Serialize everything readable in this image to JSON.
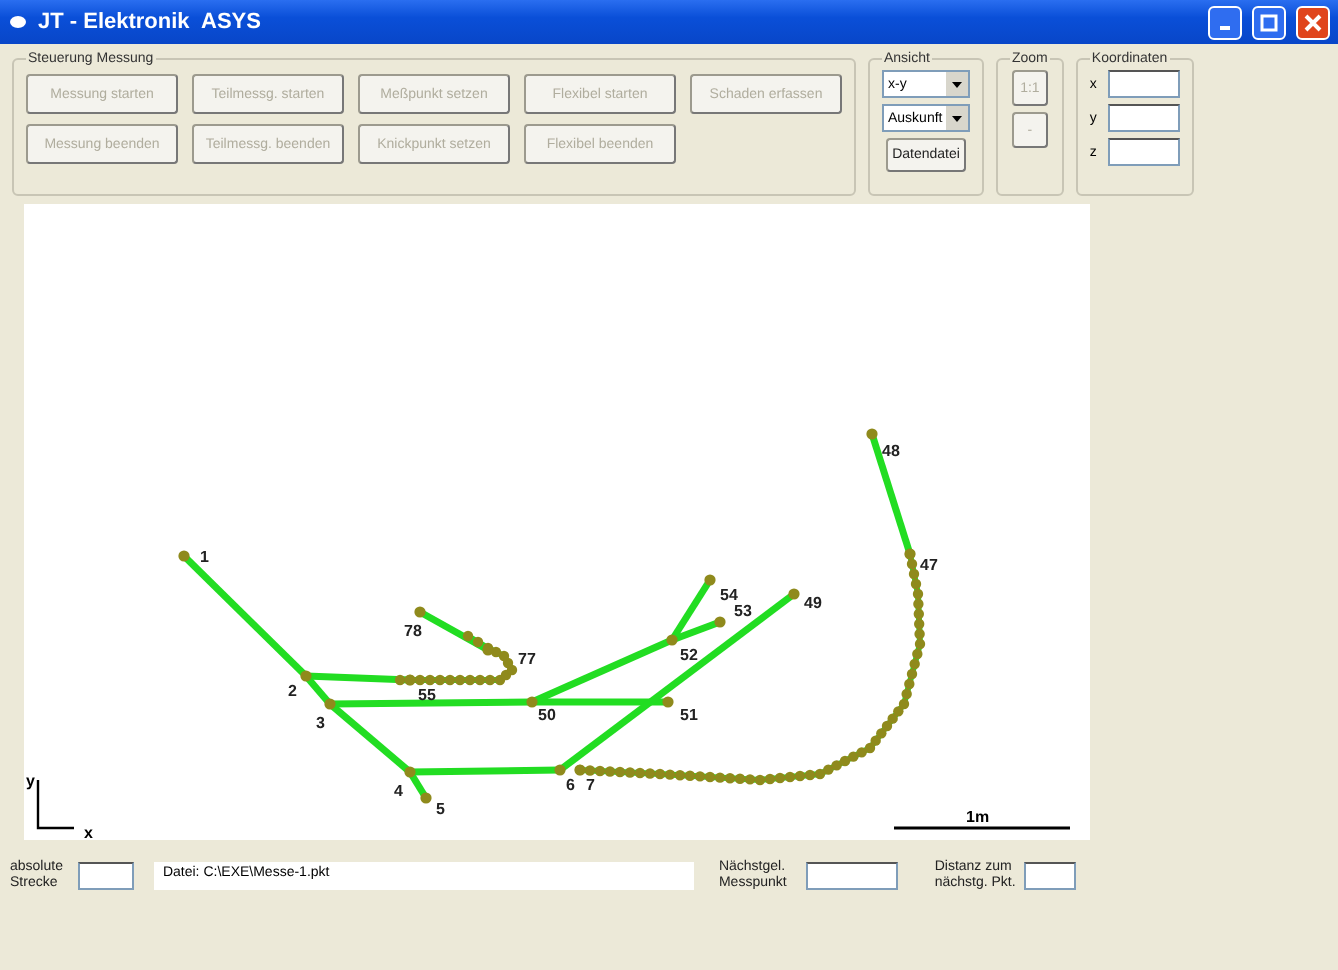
{
  "window": {
    "title": "JT - Elektronik  ASYS"
  },
  "measurement_control": {
    "title": "Steuerung Messung",
    "buttons": [
      {
        "label": "Messung starten",
        "disabled": true
      },
      {
        "label": "Teilmessg. starten",
        "disabled": true
      },
      {
        "label": "Meßpunkt setzen",
        "disabled": true
      },
      {
        "label": "Flexibel starten",
        "disabled": true
      },
      {
        "label": "Schaden erfassen",
        "disabled": true
      },
      {
        "label": "Messung beenden",
        "disabled": true
      },
      {
        "label": "Teilmessg. beenden",
        "disabled": true
      },
      {
        "label": "Knickpunkt setzen",
        "disabled": true
      },
      {
        "label": "Flexibel beenden",
        "disabled": true
      }
    ]
  },
  "view": {
    "title": "Ansicht",
    "mode": "x-y",
    "selection": "Auskunft",
    "button": "Datendatei"
  },
  "zoom": {
    "title": "Zoom",
    "buttons": [
      {
        "label": "1:1",
        "disabled": true
      },
      {
        "label": "-",
        "disabled": true
      }
    ]
  },
  "coordinates": {
    "title": "Koordinaten",
    "fields": [
      {
        "label": "x"
      },
      {
        "label": "y"
      },
      {
        "label": "z"
      }
    ]
  },
  "plot": {
    "points": [
      {
        "label": "1"
      },
      {
        "label": "2"
      },
      {
        "label": "3"
      },
      {
        "label": "4"
      },
      {
        "label": "5"
      },
      {
        "label": "6"
      },
      {
        "label": "7"
      },
      {
        "label": "50"
      },
      {
        "label": "51"
      },
      {
        "label": "52"
      },
      {
        "label": "53"
      },
      {
        "label": "54"
      },
      {
        "label": "49"
      },
      {
        "label": "55"
      },
      {
        "label": "77"
      },
      {
        "label": "78"
      },
      {
        "label": "47"
      },
      {
        "label": "48"
      }
    ],
    "scale": "1m",
    "x_axis": "x",
    "y_axis": "y"
  },
  "status": {
    "distance_label": "absolute\nStrecke",
    "file": "Datei: C:\\EXE\\Messe-1.pkt",
    "nearest_label": "Nächstgel.\nMesspunkt",
    "nearest_distance_label": "Distanz zum\nnächstg. Pkt."
  }
}
